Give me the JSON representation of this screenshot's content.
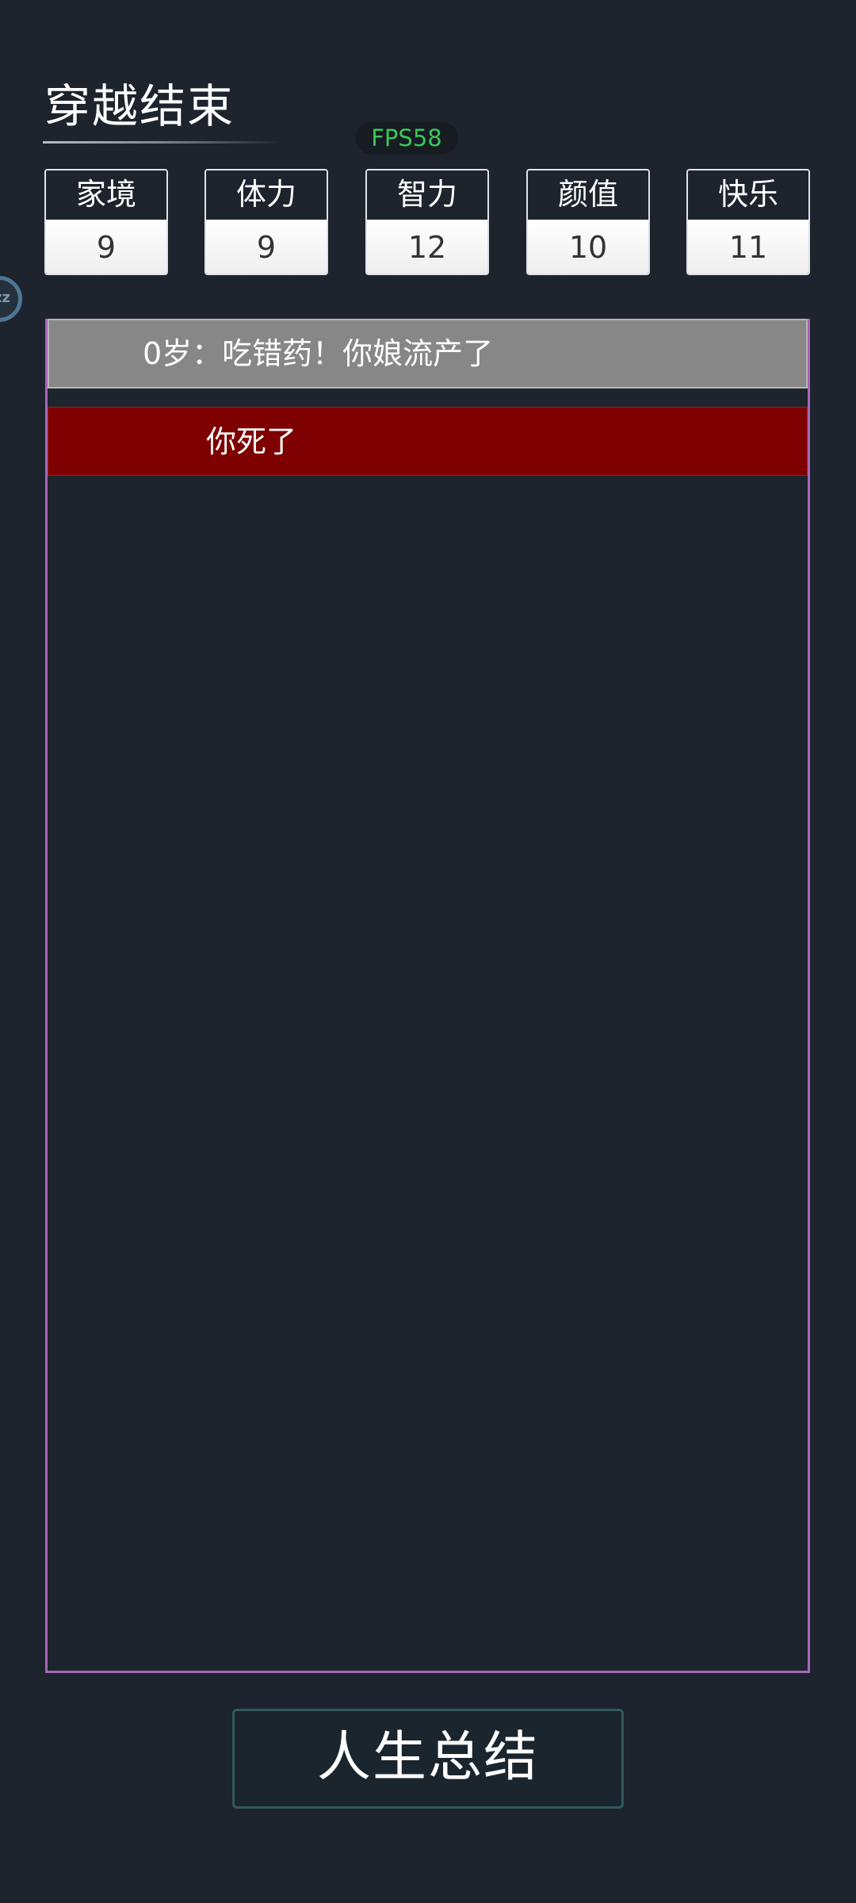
{
  "header": {
    "title": "穿越结束",
    "fps": "FPS58"
  },
  "side_handle": {
    "icon": "zz-icon",
    "label": "zz"
  },
  "stats": [
    {
      "label": "家境",
      "value": "9"
    },
    {
      "label": "体力",
      "value": "9"
    },
    {
      "label": "智力",
      "value": "12"
    },
    {
      "label": "颜值",
      "value": "10"
    },
    {
      "label": "快乐",
      "value": "11"
    }
  ],
  "log": {
    "events": [
      {
        "text": "0岁：吃错药！你娘流产了"
      },
      {
        "text": "你死了"
      }
    ]
  },
  "summary_button": {
    "label": "人生总结"
  },
  "colors": {
    "background": "#1d242d",
    "fps_text": "#39c75a",
    "event_gray": "#878787",
    "event_death": "#7e0000",
    "log_border": "#a667b8",
    "button_border": "#315a5b"
  }
}
